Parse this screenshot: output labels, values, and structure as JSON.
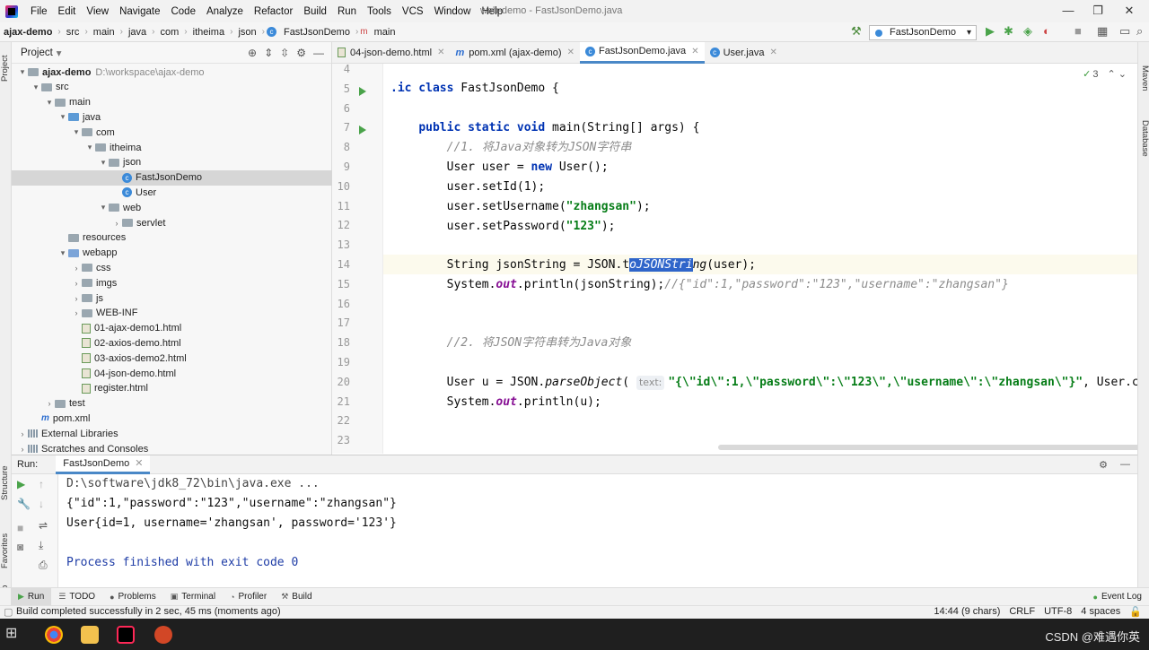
{
  "menubar": {
    "items": [
      "File",
      "Edit",
      "View",
      "Navigate",
      "Code",
      "Analyze",
      "Refactor",
      "Build",
      "Run",
      "Tools",
      "VCS",
      "Window",
      "Help"
    ],
    "window_title": "web-demo - FastJsonDemo.java"
  },
  "navbar": {
    "crumbs": [
      "ajax-demo",
      "src",
      "main",
      "java",
      "com",
      "itheima",
      "json",
      "FastJsonDemo",
      "main"
    ],
    "run_config": "FastJsonDemo"
  },
  "project": {
    "header": "Project",
    "root_path": "D:\\workspace\\ajax-demo",
    "tree": [
      {
        "label": "ajax-demo",
        "indent": 0,
        "arrow": "▾",
        "icon": "folder",
        "bold": true,
        "path": true
      },
      {
        "label": "src",
        "indent": 1,
        "arrow": "▾",
        "icon": "folder"
      },
      {
        "label": "main",
        "indent": 2,
        "arrow": "▾",
        "icon": "folder"
      },
      {
        "label": "java",
        "indent": 3,
        "arrow": "▾",
        "icon": "folder-src"
      },
      {
        "label": "com",
        "indent": 4,
        "arrow": "▾",
        "icon": "folder"
      },
      {
        "label": "itheima",
        "indent": 5,
        "arrow": "▾",
        "icon": "folder"
      },
      {
        "label": "json",
        "indent": 6,
        "arrow": "▾",
        "icon": "folder"
      },
      {
        "label": "FastJsonDemo",
        "indent": 7,
        "arrow": "",
        "icon": "class",
        "selected": true
      },
      {
        "label": "User",
        "indent": 7,
        "arrow": "",
        "icon": "class"
      },
      {
        "label": "web",
        "indent": 6,
        "arrow": "▾",
        "icon": "folder"
      },
      {
        "label": "servlet",
        "indent": 7,
        "arrow": "›",
        "icon": "folder"
      },
      {
        "label": "resources",
        "indent": 3,
        "arrow": "",
        "icon": "folder"
      },
      {
        "label": "webapp",
        "indent": 3,
        "arrow": "▾",
        "icon": "folder-blue"
      },
      {
        "label": "css",
        "indent": 4,
        "arrow": "›",
        "icon": "folder"
      },
      {
        "label": "imgs",
        "indent": 4,
        "arrow": "›",
        "icon": "folder"
      },
      {
        "label": "js",
        "indent": 4,
        "arrow": "›",
        "icon": "folder"
      },
      {
        "label": "WEB-INF",
        "indent": 4,
        "arrow": "›",
        "icon": "folder"
      },
      {
        "label": "01-ajax-demo1.html",
        "indent": 4,
        "arrow": "",
        "icon": "html"
      },
      {
        "label": "02-axios-demo.html",
        "indent": 4,
        "arrow": "",
        "icon": "html"
      },
      {
        "label": "03-axios-demo2.html",
        "indent": 4,
        "arrow": "",
        "icon": "html"
      },
      {
        "label": "04-json-demo.html",
        "indent": 4,
        "arrow": "",
        "icon": "html"
      },
      {
        "label": "register.html",
        "indent": 4,
        "arrow": "",
        "icon": "html"
      },
      {
        "label": "test",
        "indent": 2,
        "arrow": "›",
        "icon": "folder"
      },
      {
        "label": "pom.xml",
        "indent": 1,
        "arrow": "",
        "icon": "xml"
      },
      {
        "label": "External Libraries",
        "indent": 0,
        "arrow": "›",
        "icon": "lib"
      },
      {
        "label": "Scratches and Consoles",
        "indent": 0,
        "arrow": "›",
        "icon": "lib"
      }
    ]
  },
  "tabs": [
    {
      "label": "04-json-demo.html",
      "icon": "html",
      "active": false
    },
    {
      "label": "pom.xml (ajax-demo)",
      "icon": "m",
      "active": false
    },
    {
      "label": "FastJsonDemo.java",
      "icon": "class",
      "active": true
    },
    {
      "label": "User.java",
      "icon": "class",
      "active": false
    }
  ],
  "editor": {
    "inspection_count": "3",
    "line_numbers": [
      "4",
      "5",
      "6",
      "7",
      "8",
      "9",
      "10",
      "11",
      "12",
      "13",
      "14",
      "15",
      "16",
      "17",
      "18",
      "19",
      "20",
      "21",
      "22",
      "23"
    ],
    "comment1": "//1. 将Java对象转为JSON字符串",
    "comment2": "//2. 将JSON字符串转为Java对象",
    "output_comment": "//{\"id\":1,\"password\":\"123\",\"username\":\"zhangsan\"}",
    "hint_text": "text:",
    "parse_arg": "\"{\\\"id\\\":1,\\\"password\\\":\\\"123\\\",\\\"username\\\":\\\"zhangsan\\\"}\"",
    "parse_tail": ", User.cla"
  },
  "run": {
    "label": "Run:",
    "tab": "FastJsonDemo",
    "console": [
      "D:\\software\\jdk8_72\\bin\\java.exe ...",
      "{\"id\":1,\"password\":\"123\",\"username\":\"zhangsan\"}",
      "User{id=1, username='zhangsan', password='123'}",
      "",
      "Process finished with exit code 0"
    ]
  },
  "bottom_tabs": [
    "Run",
    "TODO",
    "Problems",
    "Terminal",
    "Profiler",
    "Build"
  ],
  "event_log": "Event Log",
  "status": {
    "message": "Build completed successfully in 2 sec, 45 ms (moments ago)",
    "position": "14:44 (9 chars)",
    "line_sep": "CRLF",
    "encoding": "UTF-8",
    "indent": "4 spaces"
  },
  "side_labels": {
    "project": "Project",
    "structure": "Structure",
    "favorites": "Favorites",
    "web": "Web",
    "maven": "Maven",
    "database": "Database"
  },
  "watermark": "CSDN @难遇你英"
}
